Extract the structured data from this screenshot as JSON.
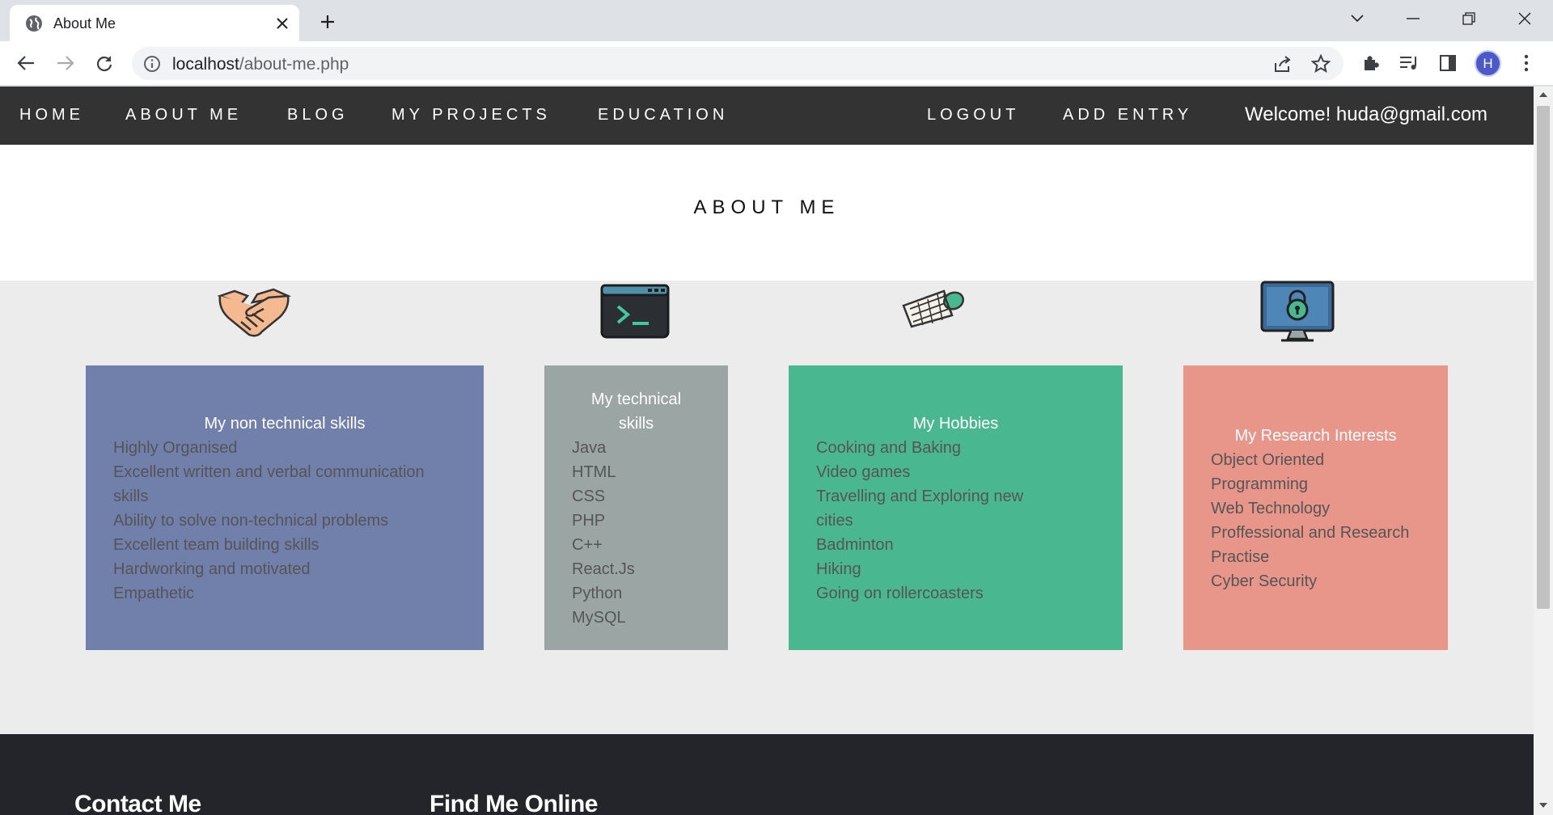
{
  "browser": {
    "tab_title": "About Me",
    "url_host": "localhost",
    "url_path": "/about-me.php",
    "profile_initial": "H"
  },
  "nav": {
    "home": "HOME",
    "about": "ABOUT ME",
    "blog": "BLOG",
    "projects": "MY PROJECTS",
    "education": "EDUCATION",
    "logout": "LOGOUT",
    "add_entry": "ADD ENTRY",
    "welcome": "Welcome! huda@gmail.com"
  },
  "page": {
    "title": "ABOUT ME"
  },
  "cards": [
    {
      "title": "My non technical skills",
      "items": [
        "Highly Organised",
        "Excellent written and verbal communication",
        "skills",
        "Ability to solve non-technical problems",
        "Excellent team building skills",
        "Hardworking and motivated",
        "Empathetic"
      ],
      "color": "#717fab"
    },
    {
      "title_lines": [
        "My technical",
        "skills"
      ],
      "items": [
        "Java",
        "HTML",
        "CSS",
        "PHP",
        "C++",
        "React.Js",
        "Python",
        "MySQL"
      ],
      "color": "#9aa5a4"
    },
    {
      "title": "My Hobbies",
      "items": [
        "Cooking and Baking",
        "Video games",
        "Travelling and Exploring new",
        "cities",
        "Badminton",
        "Hiking",
        "Going on rollercoasters"
      ],
      "color": "#49b890"
    },
    {
      "title": "My Research Interests",
      "items": [
        "Object Oriented",
        "Programming",
        "Web Technology",
        "Proffessional and Research",
        "Practise",
        "Cyber Security"
      ],
      "color": "#e8958a"
    }
  ],
  "footer": {
    "contact_heading": "Contact Me",
    "online_heading": "Find Me Online"
  },
  "colors": {
    "nav_bg": "#333333",
    "page_bg": "#ececed",
    "footer_bg": "#24252a",
    "list_text": "#555555"
  }
}
